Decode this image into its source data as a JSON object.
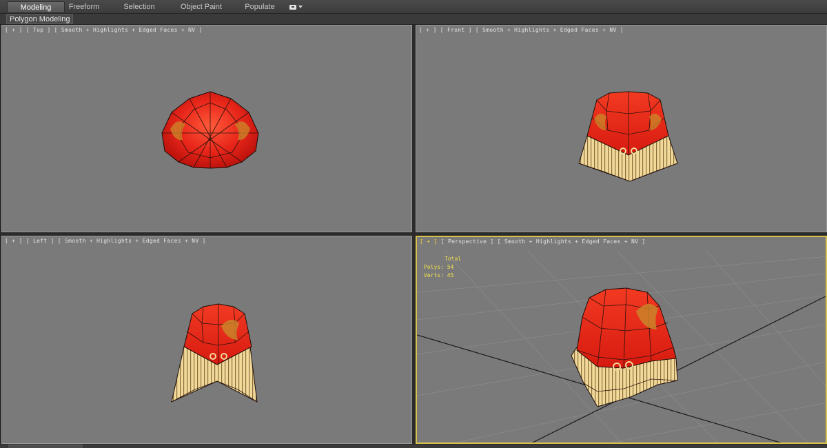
{
  "ribbon": {
    "tabs": [
      {
        "label": "Modeling",
        "active": true
      },
      {
        "label": "Freeform",
        "active": false
      },
      {
        "label": "Selection",
        "active": false
      },
      {
        "label": "Object Paint",
        "active": false
      },
      {
        "label": "Populate",
        "active": false
      }
    ]
  },
  "subpanel": {
    "label": "Polygon Modeling"
  },
  "viewports": {
    "top": {
      "plus": "[ + ]",
      "name": "[ Top ]",
      "mode": "[ Smooth + Highlights + Edged Faces + NV ]"
    },
    "front": {
      "plus": "[ + ]",
      "name": "[ Front ]",
      "mode": "[ Smooth + Highlights + Edged Faces + NV ]"
    },
    "left": {
      "plus": "[ + ]",
      "name": "[ Left ]",
      "mode": "[ Smooth + Highlights + Edged Faces + NV ]"
    },
    "persp": {
      "plus": "[ + ]",
      "name": "[ Perspective ]",
      "mode": "[ Smooth + Highlights + Edged Faces + NV ]"
    }
  },
  "stats": {
    "header": "Total",
    "polys_label": "Polys:",
    "polys_value": "54",
    "verts_label": "Verts:",
    "verts_value": "45"
  },
  "colors": {
    "viewport_bg": "#7a7a7a",
    "active_border": "#d8c24a",
    "hat_red": "#e8261a",
    "fringe": "#f1d99a",
    "stats_text": "#f0e04a"
  }
}
